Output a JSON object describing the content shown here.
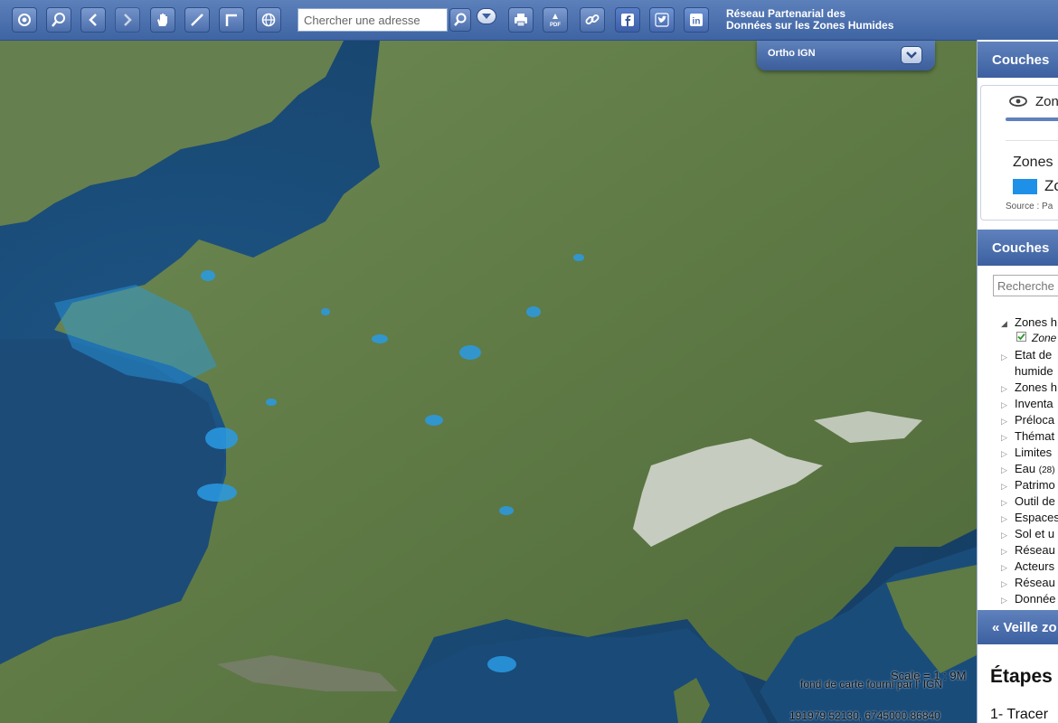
{
  "toolbar": {
    "search_placeholder": "Chercher une adresse",
    "brand_line1": "Réseau Partenarial des",
    "brand_line2": "Données sur les Zones Humides"
  },
  "map": {
    "basemap_label": "Ortho IGN",
    "scale_text": "Scale = 1 : 9M",
    "attribution": "fond de carte fourni par l' IGN",
    "coordinates": "191979.52130, 6745000.86840"
  },
  "panel": {
    "section1_title": "Couches",
    "active_layer_label": "Zon",
    "legend_title": "Zones",
    "legend_item": "Zo",
    "source_text": "Source : Pa",
    "section2_title": "Couches",
    "search_placeholder": "Recherche",
    "tree": [
      {
        "label": "Zones h",
        "expanded": true
      },
      {
        "label": "Zone",
        "checked": true
      },
      {
        "label": "Etat de",
        "expanded": false
      },
      {
        "label": "humide"
      },
      {
        "label": "Zones h",
        "expanded": false
      },
      {
        "label": "Inventa",
        "expanded": false
      },
      {
        "label": "Préloca",
        "expanded": false
      },
      {
        "label": "Thémat",
        "expanded": false
      },
      {
        "label": "Limites",
        "expanded": false
      },
      {
        "label": "Eau",
        "count": "(28)",
        "expanded": false
      },
      {
        "label": "Patrimo",
        "expanded": false
      },
      {
        "label": "Outil de",
        "expanded": false
      },
      {
        "label": "Espaces",
        "expanded": false
      },
      {
        "label": "Sol et u",
        "expanded": false
      },
      {
        "label": "Réseau",
        "expanded": false
      },
      {
        "label": "Acteurs",
        "expanded": false
      },
      {
        "label": "Réseau",
        "expanded": false
      },
      {
        "label": "Donnée",
        "expanded": false
      }
    ],
    "section3_title": "« Veille zo",
    "steps_title": "Étapes",
    "step1": "1- Tracer"
  },
  "colors": {
    "toolbar": "#4a6fb0",
    "panel_header": "#4d71b0",
    "wetland": "#2a9be6",
    "legend_swatch": "#1e90e8"
  }
}
